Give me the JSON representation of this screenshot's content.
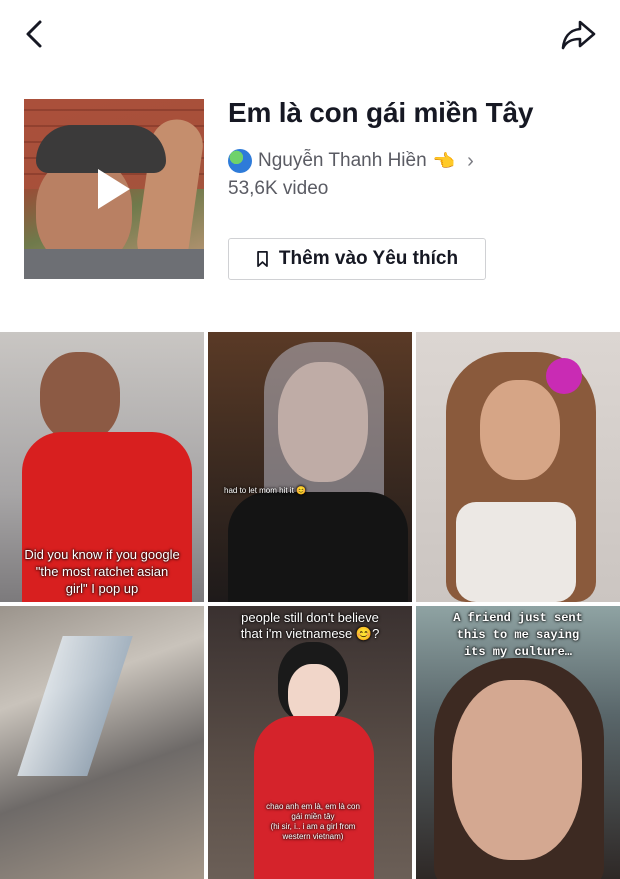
{
  "nav": {
    "back_icon": "chevron-left-icon",
    "share_icon": "share-arrow-icon"
  },
  "sound": {
    "title": "Em là con gái miền Tây",
    "author_emoji_left": "🌏",
    "author": "Nguyễn Thanh Hiền",
    "author_emoji_right": "👈",
    "video_count": "53,6K video",
    "favorite_label": "Thêm vào Yêu thích"
  },
  "videos": [
    {
      "caption": "Did you know if you google\n\"the most ratchet asian\ngirl\" I pop up"
    },
    {
      "caption": "had to let mom hit it 😊"
    },
    {
      "caption": ""
    },
    {
      "caption": ""
    },
    {
      "caption": "people still don't believe\nthat i'm vietnamese 😊?",
      "caption2": "chao anh em là, em là con\ngái miền tây\n(hi sir, i.. i am a girl from\nwestern vietnam)"
    },
    {
      "caption": "A friend just sent\nthis to me saying\nits my culture…"
    }
  ],
  "colors": {
    "text": "#161823",
    "muted": "#5a5b63",
    "border": "#d0d1d4"
  }
}
